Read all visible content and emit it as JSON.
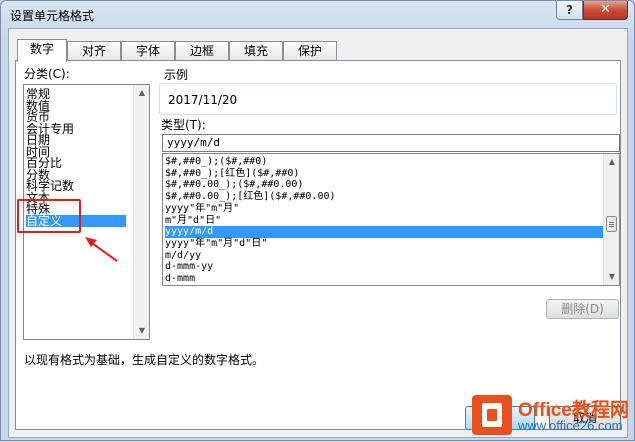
{
  "window": {
    "title": "设置单元格格式",
    "help_label": "?",
    "close_label": "✕"
  },
  "tabs": [
    {
      "label": "数字",
      "active": true
    },
    {
      "label": "对齐",
      "active": false
    },
    {
      "label": "字体",
      "active": false
    },
    {
      "label": "边框",
      "active": false
    },
    {
      "label": "填充",
      "active": false
    },
    {
      "label": "保护",
      "active": false
    }
  ],
  "category": {
    "label": "分类(C):",
    "items": [
      "常规",
      "数值",
      "货币",
      "会计专用",
      "日期",
      "时间",
      "百分比",
      "分数",
      "科学记数",
      "文本",
      "特殊",
      "自定义"
    ],
    "selected": "自定义"
  },
  "sample": {
    "label": "示例",
    "value": "2017/11/20"
  },
  "type": {
    "label": "类型(T):",
    "value": "yyyy/m/d"
  },
  "formats": {
    "items": [
      "$#,##0_);($#,##0)",
      "$#,##0_);[红色]($#,##0)",
      "$#,##0.00_);($#,##0.00)",
      "$#,##0.00_);[红色]($#,##0.00)",
      "yyyy\"年\"m\"月\"",
      "m\"月\"d\"日\"",
      "yyyy/m/d",
      "yyyy\"年\"m\"月\"d\"日\"",
      "m/d/yy",
      "d-mmm-yy",
      "d-mmm"
    ],
    "selected": "yyyy/m/d"
  },
  "buttons": {
    "delete_label": "删除(D)",
    "ok_label": "",
    "cancel_label": "取消"
  },
  "description": "以现有格式为基础，生成自定义的数字格式。",
  "watermark": {
    "title": "Office教程网",
    "url": "www.office26.com"
  },
  "colors": {
    "selection": "#3399ff",
    "annotation": "#e02020",
    "watermark_orange": "#e9501e",
    "watermark_blue": "#1e6fc9"
  }
}
